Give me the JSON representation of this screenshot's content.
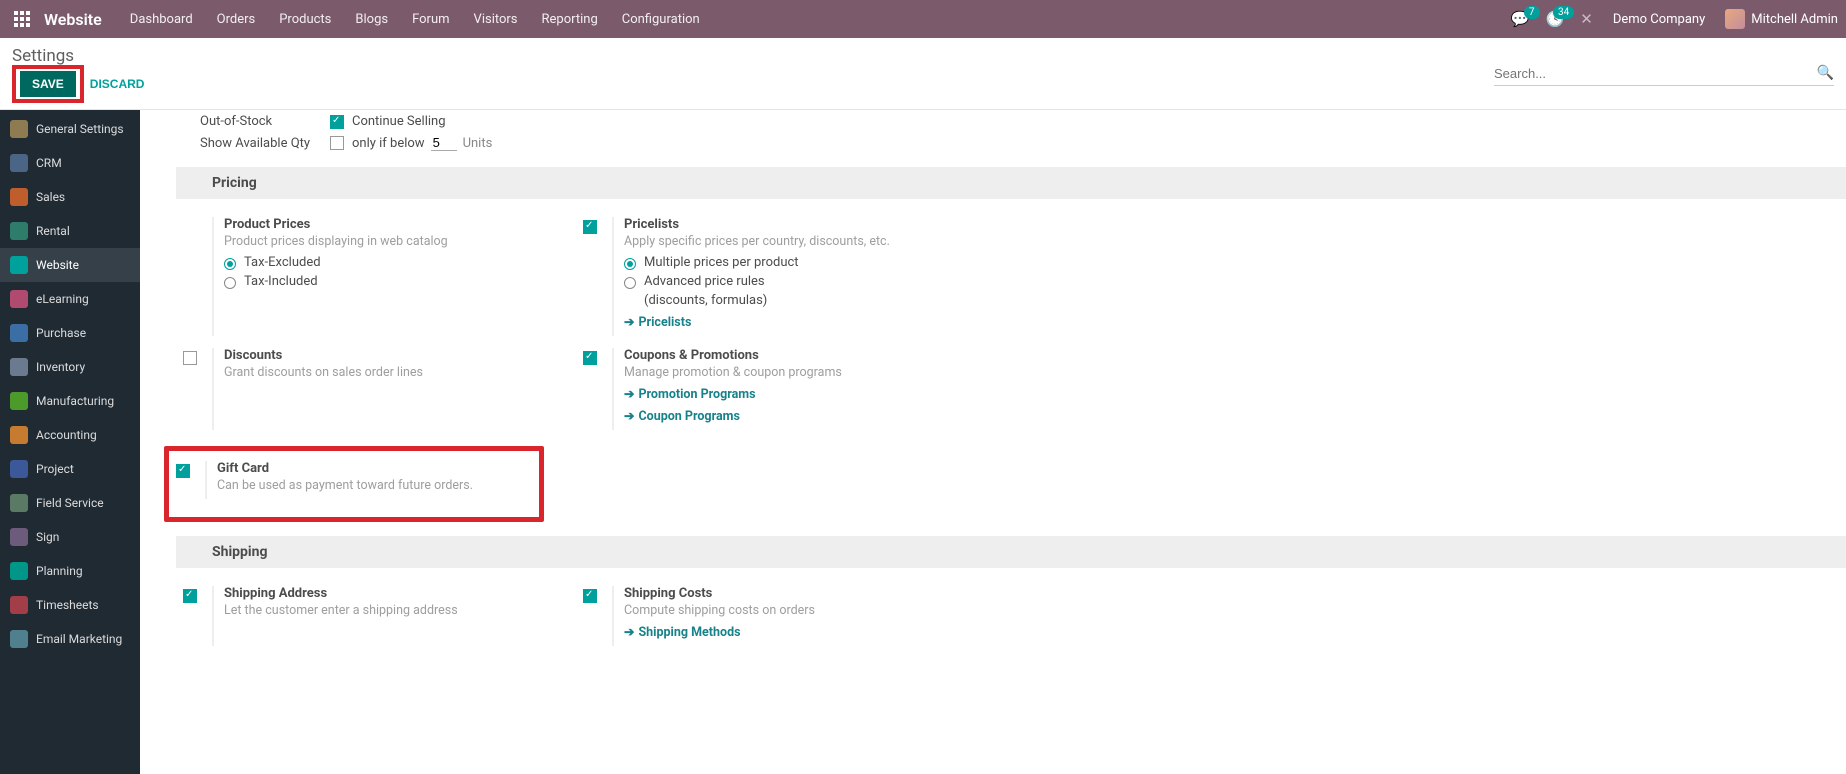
{
  "topbar": {
    "brand": "Website",
    "nav": [
      "Dashboard",
      "Orders",
      "Products",
      "Blogs",
      "Forum",
      "Visitors",
      "Reporting",
      "Configuration"
    ],
    "msg_badge": "7",
    "activity_badge": "34",
    "company": "Demo Company",
    "user": "Mitchell Admin"
  },
  "subhead": {
    "title": "Settings",
    "save": "SAVE",
    "discard": "DISCARD",
    "search_placeholder": "Search..."
  },
  "sidebar": {
    "items": [
      {
        "label": "General Settings",
        "color": "#8e7b52"
      },
      {
        "label": "CRM",
        "color": "#4b6587"
      },
      {
        "label": "Sales",
        "color": "#c05d2c"
      },
      {
        "label": "Rental",
        "color": "#2e7d6b"
      },
      {
        "label": "Website",
        "color": "#00a09d",
        "active": true
      },
      {
        "label": "eLearning",
        "color": "#b04a6e"
      },
      {
        "label": "Purchase",
        "color": "#3b6ea5"
      },
      {
        "label": "Inventory",
        "color": "#6b7a8f"
      },
      {
        "label": "Manufacturing",
        "color": "#4c9a2a"
      },
      {
        "label": "Accounting",
        "color": "#c77b30"
      },
      {
        "label": "Project",
        "color": "#3b5998"
      },
      {
        "label": "Field Service",
        "color": "#5b7a65"
      },
      {
        "label": "Sign",
        "color": "#6c5b7b"
      },
      {
        "label": "Planning",
        "color": "#009688"
      },
      {
        "label": "Timesheets",
        "color": "#a23e48"
      },
      {
        "label": "Email Marketing",
        "color": "#50808e"
      }
    ]
  },
  "inventory_tail": {
    "out_of_stock_label": "Out-of-Stock",
    "out_of_stock_option": "Continue Selling",
    "show_qty_label": "Show Available Qty",
    "only_if_below": "only if below",
    "qty_value": "5",
    "units": "Units"
  },
  "sections": {
    "pricing": "Pricing",
    "shipping": "Shipping"
  },
  "pricing": {
    "product_prices": {
      "title": "Product Prices",
      "desc": "Product prices displaying in web catalog",
      "opt1": "Tax-Excluded",
      "opt2": "Tax-Included"
    },
    "pricelists": {
      "title": "Pricelists",
      "desc": "Apply specific prices per country, discounts, etc.",
      "opt1": "Multiple prices per product",
      "opt2": "Advanced price rules",
      "opt2_sub": "(discounts, formulas)",
      "link": "Pricelists"
    },
    "discounts": {
      "title": "Discounts",
      "desc": "Grant discounts on sales order lines"
    },
    "coupons": {
      "title": "Coupons & Promotions",
      "desc": "Manage promotion & coupon programs",
      "link1": "Promotion Programs",
      "link2": "Coupon Programs"
    },
    "gift_card": {
      "title": "Gift Card",
      "desc": "Can be used as payment toward future orders."
    }
  },
  "shipping": {
    "address": {
      "title": "Shipping Address",
      "desc": "Let the customer enter a shipping address"
    },
    "costs": {
      "title": "Shipping Costs",
      "desc": "Compute shipping costs on orders",
      "link": "Shipping Methods"
    }
  }
}
